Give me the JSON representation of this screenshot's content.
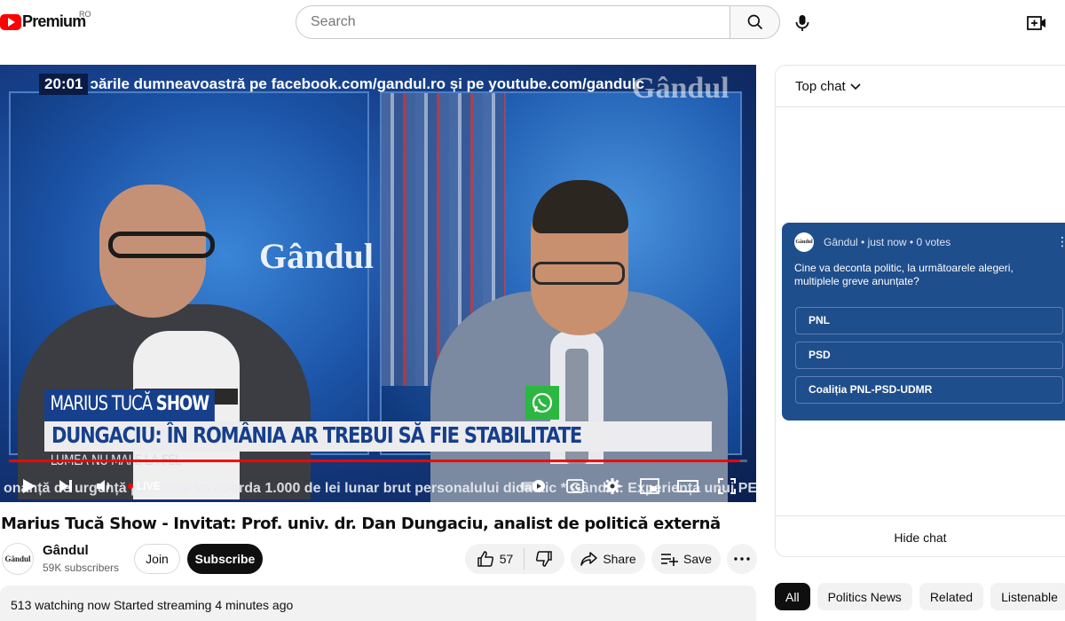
{
  "header": {
    "logo_text": "Premium",
    "region": "RO",
    "search_placeholder": "Search"
  },
  "video": {
    "ticker_time": "20:01",
    "ticker_text": "ɔările  dumneavoastră pe facebook.com/gandul.ro și pe youtube.com/gandulc",
    "brand": "Gândul",
    "show_name_light": "MARIUS TUCĂ",
    "show_name_bold": "SHOW",
    "headline": "DUNGACIU: ÎN ROMÂNIA AR TREBUI SĂ FIE STABILITATE",
    "subline": "LUMEA NU MAI E LA FEL",
    "bottom_ticker": "onanță de urgență prin care va acorda 1.000 de lei lunar brut personalului didactic * Gândul: Experiența unui PERN",
    "live_label": "LIVE",
    "progress": 0.99
  },
  "meta": {
    "title": "Marius Tucă Show - Invitat: Prof. univ. dr. Dan Dungaciu, analist de politică externă",
    "channel_name": "Gândul",
    "channel_avatar_text": "Gândul",
    "subscribers": "59K subscribers",
    "join_label": "Join",
    "subscribe_label": "Subscribe",
    "like_count": "57",
    "share_label": "Share",
    "save_label": "Save",
    "description": "513 watching now  Started streaming 4 minutes ago"
  },
  "chat": {
    "mode_label": "Top chat",
    "poll": {
      "avatar_text": "Gândul",
      "meta": "Gândul • just now • 0 votes",
      "question": "Cine va deconta politic, la următoarele alegeri, multiplele greve anunțate?",
      "options": [
        "PNL",
        "PSD",
        "Coaliția PNL-PSD-UDMR"
      ]
    },
    "hide_label": "Hide chat"
  },
  "chips": [
    "All",
    "Politics News",
    "Related",
    "Listenable"
  ],
  "colors": {
    "brand_red": "#ff0000",
    "poll_bg": "#1f4e8c",
    "lower_third_blue": "#163f8c"
  },
  "icons": [
    "youtube-logo-icon",
    "search-icon",
    "mic-icon",
    "create-icon",
    "play-icon",
    "next-icon",
    "volume-icon",
    "autoplay-icon",
    "cc-icon",
    "settings-icon",
    "miniplayer-icon",
    "theater-icon",
    "fullscreen-icon",
    "like-icon",
    "dislike-icon",
    "share-icon",
    "save-icon",
    "more-icon",
    "chevron-down-icon",
    "whatsapp-icon"
  ]
}
